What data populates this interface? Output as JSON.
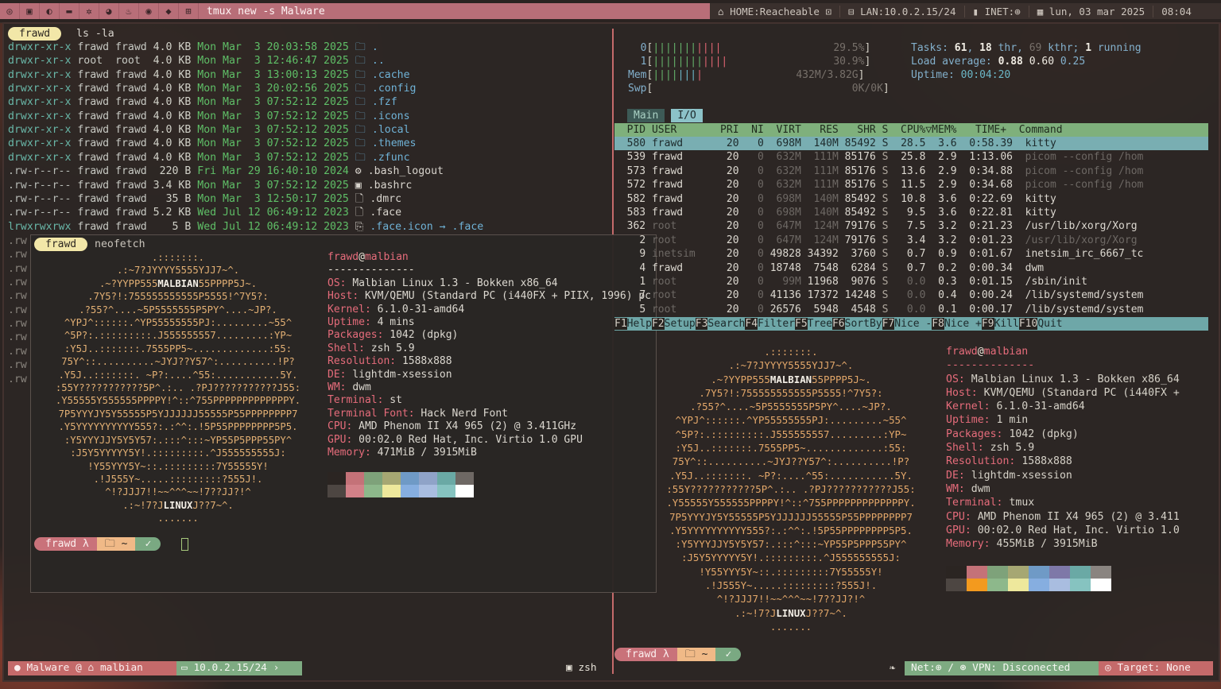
{
  "topbar": {
    "title": "tmux new -s Malware",
    "home": "HOME:Reacheable",
    "lan": "LAN:10.0.2.15/24",
    "inet": "INET:",
    "date": "lun, 03 mar 2025",
    "time": "08:04"
  },
  "left_pane": {
    "prompt_user": "frawd",
    "command": "ls -la",
    "listing": [
      {
        "perm": "drwxr-xr-x",
        "user": "frawd",
        "group": "frawd",
        "size": "4.0 KB",
        "date": "Mon Mar  3 20:03:58 2025",
        "icon": "folder",
        "name": "."
      },
      {
        "perm": "drwxr-xr-x",
        "user": "root",
        "group": "root",
        "size": "4.0 KB",
        "date": "Mon Mar  3 12:46:47 2025",
        "icon": "folder",
        "name": ".."
      },
      {
        "perm": "drwxr-xr-x",
        "user": "frawd",
        "group": "frawd",
        "size": "4.0 KB",
        "date": "Mon Mar  3 13:00:13 2025",
        "icon": "folder",
        "name": ".cache"
      },
      {
        "perm": "drwxr-xr-x",
        "user": "frawd",
        "group": "frawd",
        "size": "4.0 KB",
        "date": "Mon Mar  3 20:02:56 2025",
        "icon": "folder",
        "name": ".config"
      },
      {
        "perm": "drwxr-xr-x",
        "user": "frawd",
        "group": "frawd",
        "size": "4.0 KB",
        "date": "Mon Mar  3 07:52:12 2025",
        "icon": "folder",
        "name": ".fzf"
      },
      {
        "perm": "drwxr-xr-x",
        "user": "frawd",
        "group": "frawd",
        "size": "4.0 KB",
        "date": "Mon Mar  3 07:52:12 2025",
        "icon": "folder",
        "name": ".icons"
      },
      {
        "perm": "drwxr-xr-x",
        "user": "frawd",
        "group": "frawd",
        "size": "4.0 KB",
        "date": "Mon Mar  3 07:52:12 2025",
        "icon": "folder",
        "name": ".local"
      },
      {
        "perm": "drwxr-xr-x",
        "user": "frawd",
        "group": "frawd",
        "size": "4.0 KB",
        "date": "Mon Mar  3 07:52:12 2025",
        "icon": "folder",
        "name": ".themes"
      },
      {
        "perm": "drwxr-xr-x",
        "user": "frawd",
        "group": "frawd",
        "size": "4.0 KB",
        "date": "Mon Mar  3 07:52:12 2025",
        "icon": "folder",
        "name": ".zfunc"
      },
      {
        "perm": ".rw-r--r--",
        "user": "frawd",
        "group": "frawd",
        "size": "220 B",
        "date": "Fri Mar 29 16:40:10 2024",
        "icon": "gear",
        "name": ".bash_logout"
      },
      {
        "perm": ".rw-r--r--",
        "user": "frawd",
        "group": "frawd",
        "size": "3.4 KB",
        "date": "Mon Mar  3 07:52:12 2025",
        "icon": "term",
        "name": ".bashrc"
      },
      {
        "perm": ".rw-r--r--",
        "user": "frawd",
        "group": "frawd",
        "size": "35 B",
        "date": "Mon Mar  3 12:50:17 2025",
        "icon": "file",
        "name": ".dmrc"
      },
      {
        "perm": ".rw-r--r--",
        "user": "frawd",
        "group": "frawd",
        "size": "5.2 KB",
        "date": "Wed Jul 12 06:49:12 2023",
        "icon": "file",
        "name": ".face"
      },
      {
        "perm": "lrwxrwxrwx",
        "user": "frawd",
        "group": "frawd",
        "size": "5 B",
        "date": "Wed Jul 12 06:49:12 2023",
        "icon": "link",
        "name": ".face.icon → .face"
      }
    ]
  },
  "neofetch_float": {
    "prompt_user": "frawd",
    "command": "neofetch",
    "header_user": "frawd",
    "header_host": "malbian",
    "separator": "--------------",
    "ascii": [
      ".:::::::.",
      ".:~7?JYYYY5555YJJ7~^.",
      ".~?YYPP555MALBIAN55PPPP5J~.",
      ".7Y5?!:755555555555P5555!^7Y5?:",
      ".?55?^....~5P5555555P5PY^....~JP?.",
      "^YPJ^::::::.^YP55555555PJ:.........~55^",
      "^5P?:.:::::::::.J555555557.........:YP~",
      ":Y5J..:::::::.7555PP5~.............:55:",
      "75Y^::..........~JYJ??Y57^:..........!P?",
      ".Y5J..:::::::. ~P?:....^55:...........5Y.",
      ":55Y???????????5P^.:.. .?PJ???????????J55:",
      ".Y55555Y555555PPPPY!^::^755PPPPPPPPPPPPPY.",
      "7P5YYYJY5Y55555P5YJJJJJJ55555P55PPPPPPPP7",
      ".Y5YYYYYYYYYY555?:.:^^:.!5P55PPPPPPPP5P5.",
      ":Y5YYYJJY5Y5Y57:.:::^:::~YP55P5PPP55PY^",
      ":J5Y5YYYYY5Y!.:::::::::.^J555555555J:",
      "!Y55YYY5Y~::.:::::::::7Y55555Y!",
      ".!J555Y~.....:::::::::?555J!.",
      "^!?JJJ7!!~~^^^~~!7??JJ?!^",
      ".:~!7?JLINUXJ??7~^.",
      "......."
    ],
    "info": [
      {
        "k": "OS",
        "v": "Malbian Linux 1.3 - Bokken x86_64"
      },
      {
        "k": "Host",
        "v": "KVM/QEMU (Standard PC (i440FX + PIIX, 1996) pc"
      },
      {
        "k": "Kernel",
        "v": "6.1.0-31-amd64"
      },
      {
        "k": "Uptime",
        "v": "4 mins"
      },
      {
        "k": "Packages",
        "v": "1042 (dpkg)"
      },
      {
        "k": "Shell",
        "v": "zsh 5.9"
      },
      {
        "k": "Resolution",
        "v": "1588x888"
      },
      {
        "k": "DE",
        "v": "lightdm-xsession"
      },
      {
        "k": "WM",
        "v": "dwm"
      },
      {
        "k": "Terminal",
        "v": "st"
      },
      {
        "k": "Terminal Font",
        "v": "Hack Nerd Font"
      },
      {
        "k": "CPU",
        "v": "AMD Phenom II X4 965 (2) @ 3.411GHz"
      },
      {
        "k": "GPU",
        "v": "00:02.0 Red Hat, Inc. Virtio 1.0 GPU"
      },
      {
        "k": "Memory",
        "v": "471MiB / 3915MiB"
      }
    ],
    "palette_top": [
      "#2b2522",
      "#c47278",
      "#7ea27a",
      "#a6a773",
      "#6f9ac6",
      "#8fa3c8",
      "#6aa9a5",
      "#6e6864"
    ],
    "palette_bottom": [
      "#4d4642",
      "#d28188",
      "#8db88b",
      "#eee89c",
      "#86aee0",
      "#a9bde0",
      "#86c3c0",
      "#ffffff"
    ],
    "prompt_dir": "~"
  },
  "htop": {
    "cpu0": "29.5%",
    "cpu1": "30.9%",
    "mem": "432M/3.82G",
    "swp": "0K/0K",
    "tasks_label": "Tasks:",
    "tasks": "61",
    "thr": "18",
    "kthr": "69",
    "running": "1",
    "load_label": "Load average:",
    "load1": "0.88",
    "load5": "0.60",
    "load15": "0.25",
    "uptime_label": "Uptime:",
    "uptime": "00:04:20",
    "tabs": [
      "Main",
      "I/O"
    ],
    "header": "  PID USER       PRI  NI  VIRT   RES   SHR S  CPU%▽MEM%   TIME+  Command",
    "rows": [
      {
        "pid": "580",
        "user": "frawd",
        "pri": "20",
        "ni": "0",
        "virt": "698M",
        "res": "140M",
        "shr": "85492",
        "s": "S",
        "cpu": "28.5",
        "mem": "3.6",
        "time": "0:58.39",
        "cmd": "kitty"
      },
      {
        "pid": "539",
        "user": "frawd",
        "pri": "20",
        "ni": "0",
        "virt": "632M",
        "res": "111M",
        "shr": "85176",
        "s": "S",
        "cpu": "25.8",
        "mem": "2.9",
        "time": "1:13.06",
        "cmd": "picom --config /hom"
      },
      {
        "pid": "573",
        "user": "frawd",
        "pri": "20",
        "ni": "0",
        "virt": "632M",
        "res": "111M",
        "shr": "85176",
        "s": "S",
        "cpu": "13.6",
        "mem": "2.9",
        "time": "0:34.88",
        "cmd": "picom --config /hom"
      },
      {
        "pid": "572",
        "user": "frawd",
        "pri": "20",
        "ni": "0",
        "virt": "632M",
        "res": "111M",
        "shr": "85176",
        "s": "S",
        "cpu": "11.5",
        "mem": "2.9",
        "time": "0:34.68",
        "cmd": "picom --config /hom"
      },
      {
        "pid": "582",
        "user": "frawd",
        "pri": "20",
        "ni": "0",
        "virt": "698M",
        "res": "140M",
        "shr": "85492",
        "s": "S",
        "cpu": "10.8",
        "mem": "3.6",
        "time": "0:22.69",
        "cmd": "kitty"
      },
      {
        "pid": "583",
        "user": "frawd",
        "pri": "20",
        "ni": "0",
        "virt": "698M",
        "res": "140M",
        "shr": "85492",
        "s": "S",
        "cpu": "9.5",
        "mem": "3.6",
        "time": "0:22.81",
        "cmd": "kitty"
      },
      {
        "pid": "362",
        "user": "root",
        "pri": "20",
        "ni": "0",
        "virt": "647M",
        "res": "124M",
        "shr": "79176",
        "s": "S",
        "cpu": "7.5",
        "mem": "3.2",
        "time": "0:21.23",
        "cmd": "/usr/lib/xorg/Xorg"
      },
      {
        "pid": "2",
        "user": "root",
        "pri": "20",
        "ni": "0",
        "virt": "647M",
        "res": "124M",
        "shr": "79176",
        "s": "S",
        "cpu": "3.4",
        "mem": "3.2",
        "time": "0:01.23",
        "cmd": "/usr/lib/xorg/Xorg"
      },
      {
        "pid": "9",
        "user": "inetsim",
        "pri": "20",
        "ni": "0",
        "virt": "49828",
        "res": "34392",
        "shr": "3760",
        "s": "S",
        "cpu": "0.7",
        "mem": "0.9",
        "time": "0:01.67",
        "cmd": "inetsim_irc_6667_tc"
      },
      {
        "pid": "4",
        "user": "frawd",
        "pri": "20",
        "ni": "0",
        "virt": "18748",
        "res": "7548",
        "shr": "6284",
        "s": "S",
        "cpu": "0.7",
        "mem": "0.2",
        "time": "0:00.34",
        "cmd": "dwm"
      },
      {
        "pid": "1",
        "user": "root",
        "pri": "20",
        "ni": "0",
        "virt": "99M",
        "res": "11968",
        "shr": "9076",
        "s": "S",
        "cpu": "0.0",
        "mem": "0.3",
        "time": "0:01.15",
        "cmd": "/sbin/init"
      },
      {
        "pid": "7",
        "user": "root",
        "pri": "20",
        "ni": "0",
        "virt": "41136",
        "res": "17372",
        "shr": "14248",
        "s": "S",
        "cpu": "0.0",
        "mem": "0.4",
        "time": "0:00.24",
        "cmd": "/lib/systemd/system"
      },
      {
        "pid": "5",
        "user": "root",
        "pri": "20",
        "ni": "0",
        "virt": "26576",
        "res": "5948",
        "shr": "4548",
        "s": "S",
        "cpu": "0.0",
        "mem": "0.1",
        "time": "0:00.17",
        "cmd": "/lib/systemd/system"
      }
    ],
    "fkeys": [
      {
        "k": "F1",
        "l": "Help"
      },
      {
        "k": "F2",
        "l": "Setup"
      },
      {
        "k": "F3",
        "l": "Search"
      },
      {
        "k": "F4",
        "l": "Filter"
      },
      {
        "k": "F5",
        "l": "Tree"
      },
      {
        "k": "F6",
        "l": "SortBy"
      },
      {
        "k": "F7",
        "l": "Nice -"
      },
      {
        "k": "F8",
        "l": "Nice +"
      },
      {
        "k": "F9",
        "l": "Kill"
      },
      {
        "k": "F10",
        "l": "Quit"
      }
    ]
  },
  "neofetch_right": {
    "header_user": "frawd",
    "header_host": "malbian",
    "separator": "--------------",
    "info": [
      {
        "k": "OS",
        "v": "Malbian Linux 1.3 - Bokken x86_64"
      },
      {
        "k": "Host",
        "v": "KVM/QEMU (Standard PC (i440FX +"
      },
      {
        "k": "Kernel",
        "v": "6.1.0-31-amd64"
      },
      {
        "k": "Uptime",
        "v": "1 min"
      },
      {
        "k": "Packages",
        "v": "1042 (dpkg)"
      },
      {
        "k": "Shell",
        "v": "zsh 5.9"
      },
      {
        "k": "Resolution",
        "v": "1588x888"
      },
      {
        "k": "DE",
        "v": "lightdm-xsession"
      },
      {
        "k": "WM",
        "v": "dwm"
      },
      {
        "k": "Terminal",
        "v": "tmux"
      },
      {
        "k": "CPU",
        "v": "AMD Phenom II X4 965 (2) @ 3.411"
      },
      {
        "k": "GPU",
        "v": "00:02.0 Red Hat, Inc. Virtio 1.0"
      },
      {
        "k": "Memory",
        "v": "455MiB / 3915MiB"
      }
    ],
    "palette_top": [
      "#2b2522",
      "#c47278",
      "#7ea27a",
      "#a6a773",
      "#6f9ac6",
      "#7e78a8",
      "#6aa9a5",
      "#8a8480"
    ],
    "palette_bottom": [
      "#4d4642",
      "#f39a1e",
      "#8db88b",
      "#eee89c",
      "#86aee0",
      "#a9bde0",
      "#86c3c0",
      "#ffffff"
    ],
    "prompt_user": "frawd",
    "prompt_dir": "~"
  },
  "statusbar": {
    "session": "Malware",
    "host": "malbian",
    "ip": "10.0.2.15/24",
    "window": "zsh",
    "net": "Net:",
    "vpn": "VPN: Disconected",
    "target": "Target: None"
  }
}
